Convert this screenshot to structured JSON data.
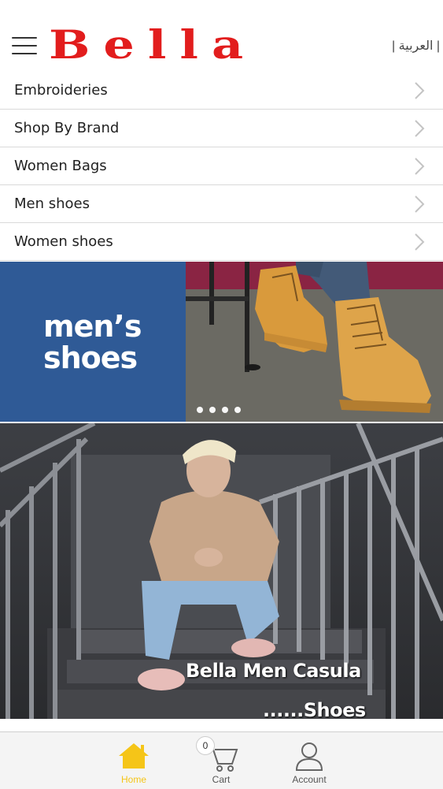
{
  "header": {
    "menu_icon": "hamburger-icon",
    "logo_text": "Bella",
    "language_switch": "| العربية |",
    "brand_color": "#e21d1d"
  },
  "categories": [
    {
      "label": "Embroideries"
    },
    {
      "label": "Shop By Brand"
    },
    {
      "label": "Women Bags"
    },
    {
      "label": "Men shoes"
    },
    {
      "label": "Women shoes"
    }
  ],
  "hero_banner": {
    "line1": "men’s",
    "line2": "shoes",
    "background_color": "#2f5a96",
    "slides": 4
  },
  "promo_banner": {
    "caption_line1": "Bella  Men Casula",
    "caption_line2": "......Shoes"
  },
  "bottom_nav": {
    "home_label": "Home",
    "cart_label": "Cart",
    "cart_count": "0",
    "account_label": "Account",
    "active_color": "#f5c518"
  }
}
